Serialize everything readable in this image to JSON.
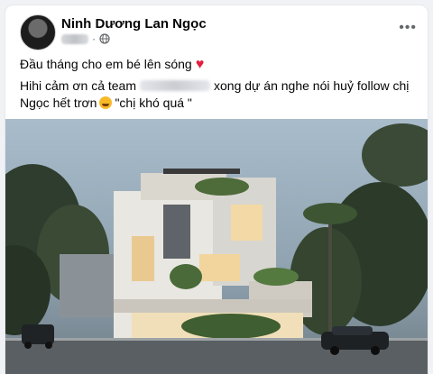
{
  "post": {
    "author": "Ninh Dương Lan Ngọc",
    "meta_separator": "·",
    "line1": "Đầu tháng cho em bé lên sóng",
    "line2_part1": "Hihi cảm ơn cả team",
    "line2_part2": "xong dự án nghe nói huỷ follow chị",
    "line3_part1": "Ngọc hết trơn",
    "line3_part2": "\"chị khó quá \""
  },
  "icons": {
    "audience": "globe-icon",
    "options": "more-options-icon",
    "heart": "red-heart-emoji",
    "laugh": "laughing-emoji"
  },
  "colors": {
    "text": "#050505",
    "secondary": "#65676b",
    "heart": "#e41e3f"
  }
}
